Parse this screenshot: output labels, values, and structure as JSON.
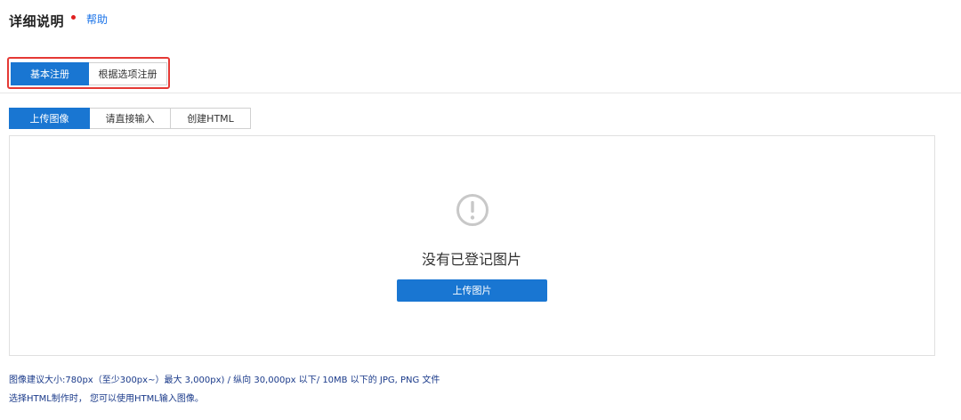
{
  "header": {
    "title": "详细说明",
    "help_label": "帮助"
  },
  "registration_tabs": [
    {
      "label": "基本注册",
      "active": true
    },
    {
      "label": "根据选项注册",
      "active": false
    }
  ],
  "sub_tabs": [
    {
      "label": "上传图像",
      "active": true
    },
    {
      "label": "请直接输入",
      "active": false
    },
    {
      "label": "创建HTML",
      "active": false
    }
  ],
  "upload_panel": {
    "icon": "alert-circle-icon",
    "empty_message": "没有已登记图片",
    "upload_button_label": "上传图片"
  },
  "notes": {
    "line1": "图像建议大小:780px（至少300px~）最大 3,000px) / 纵向 30,000px 以下/ 10MB 以下的 JPG, PNG 文件",
    "line2": "选择HTML制作时， 您可以使用HTML输入图像。"
  },
  "colors": {
    "primary": "#1976d2",
    "highlight_border": "#e53935",
    "required_dot": "#e02020",
    "link": "#1a73e8"
  }
}
